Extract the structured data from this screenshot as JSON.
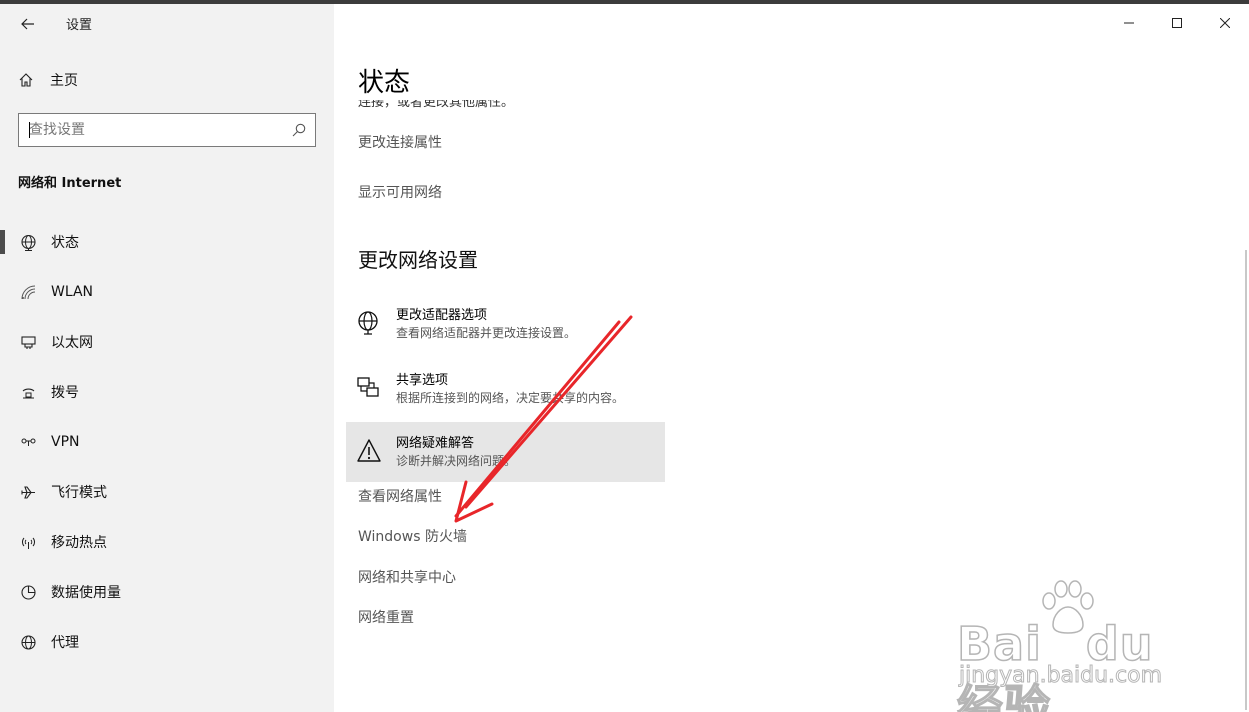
{
  "window": {
    "title": "设置",
    "controls": {
      "minimize": "minimize",
      "maximize": "maximize",
      "close": "close"
    }
  },
  "sidebar": {
    "home_label": "主页",
    "search_placeholder": "查找设置",
    "section_title": "网络和 Internet",
    "items": [
      {
        "label": "状态",
        "icon": "globe-status-icon",
        "active": true
      },
      {
        "label": "WLAN",
        "icon": "wifi-icon"
      },
      {
        "label": "以太网",
        "icon": "ethernet-icon"
      },
      {
        "label": "拨号",
        "icon": "dialup-icon"
      },
      {
        "label": "VPN",
        "icon": "vpn-icon"
      },
      {
        "label": "飞行模式",
        "icon": "airplane-icon"
      },
      {
        "label": "移动热点",
        "icon": "hotspot-icon"
      },
      {
        "label": "数据使用量",
        "icon": "data-usage-icon"
      },
      {
        "label": "代理",
        "icon": "globe-icon"
      }
    ]
  },
  "main": {
    "title": "状态",
    "clipped_text": "连接，或者更改其他属性。",
    "links_top": [
      "更改连接属性",
      "显示可用网络"
    ],
    "section_heading": "更改网络设置",
    "options": [
      {
        "title": "更改适配器选项",
        "subtitle": "查看网络适配器并更改连接设置。",
        "icon": "adapter-globe-icon"
      },
      {
        "title": "共享选项",
        "subtitle": "根据所连接到的网络，决定要共享的内容。",
        "icon": "sharing-icon"
      },
      {
        "title": "网络疑难解答",
        "subtitle": "诊断并解决网络问题。",
        "icon": "warning-icon"
      }
    ],
    "links_bottom": [
      "查看网络属性",
      "Windows 防火墙",
      "网络和共享中心",
      "网络重置"
    ]
  },
  "watermark": {
    "logo": "Bai du 经验",
    "url": "jingyan.baidu.com"
  },
  "colors": {
    "sidebar_bg": "#f2f2f2",
    "hover_bg": "#e6e6e6",
    "arrow": "#e8262a"
  }
}
